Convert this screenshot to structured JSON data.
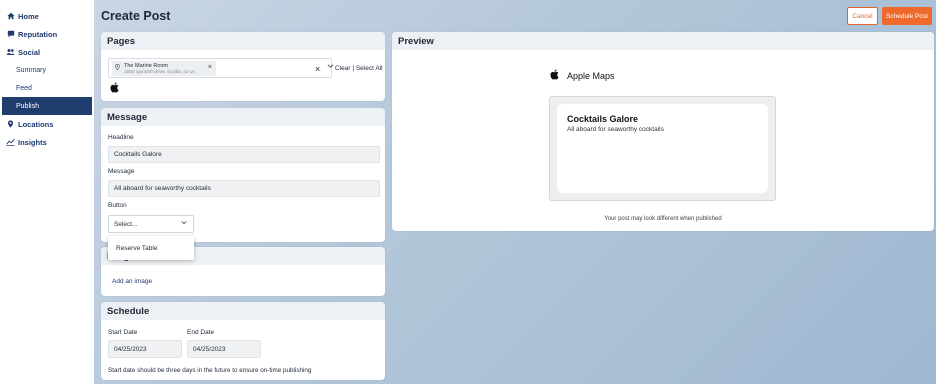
{
  "sidebar": {
    "items": [
      {
        "label": "Home",
        "icon": "home-icon"
      },
      {
        "label": "Reputation",
        "icon": "flag-icon"
      },
      {
        "label": "Social",
        "icon": "users-icon"
      },
      {
        "label": "Summary"
      },
      {
        "label": "Feed"
      },
      {
        "label": "Publish",
        "active": true
      },
      {
        "label": "Locations",
        "icon": "pin-icon"
      },
      {
        "label": "Insights",
        "icon": "chart-icon"
      }
    ]
  },
  "header": {
    "title": "Create Post",
    "cancel_label": "Cancel",
    "schedule_label": "Schedule Post"
  },
  "pages": {
    "title": "Pages",
    "chip_name": "The Marine Room",
    "chip_address": "2000 spindrift drive, la jolla, ca us",
    "clear_select_all": "Clear | Select All"
  },
  "message": {
    "title": "Message",
    "headline_label": "Headline",
    "headline_value": "Cocktails Galore",
    "message_label": "Message",
    "message_value": "All aboard for seaworthy cocktails",
    "button_label": "Button",
    "select_placeholder": "Select...",
    "dropdown_option": "Reserve Table"
  },
  "image": {
    "title": "Image",
    "add_link": "Add an image"
  },
  "schedule": {
    "title": "Schedule",
    "start_label": "Start Date",
    "start_value": "04/25/2023",
    "end_label": "End Date",
    "end_value": "04/25/2023",
    "note": "Start date should be three days in the future to ensure on-time publishing"
  },
  "preview": {
    "title": "Preview",
    "platform": "Apple Maps",
    "post_title": "Cocktails Galore",
    "post_body": "All aboard for seaworthy cocktails",
    "footer_note": "Your post may look different when published"
  },
  "colors": {
    "accent": "#ee6a2c",
    "nav_active": "#1f3e6e",
    "nav_text": "#1e3a6e"
  }
}
